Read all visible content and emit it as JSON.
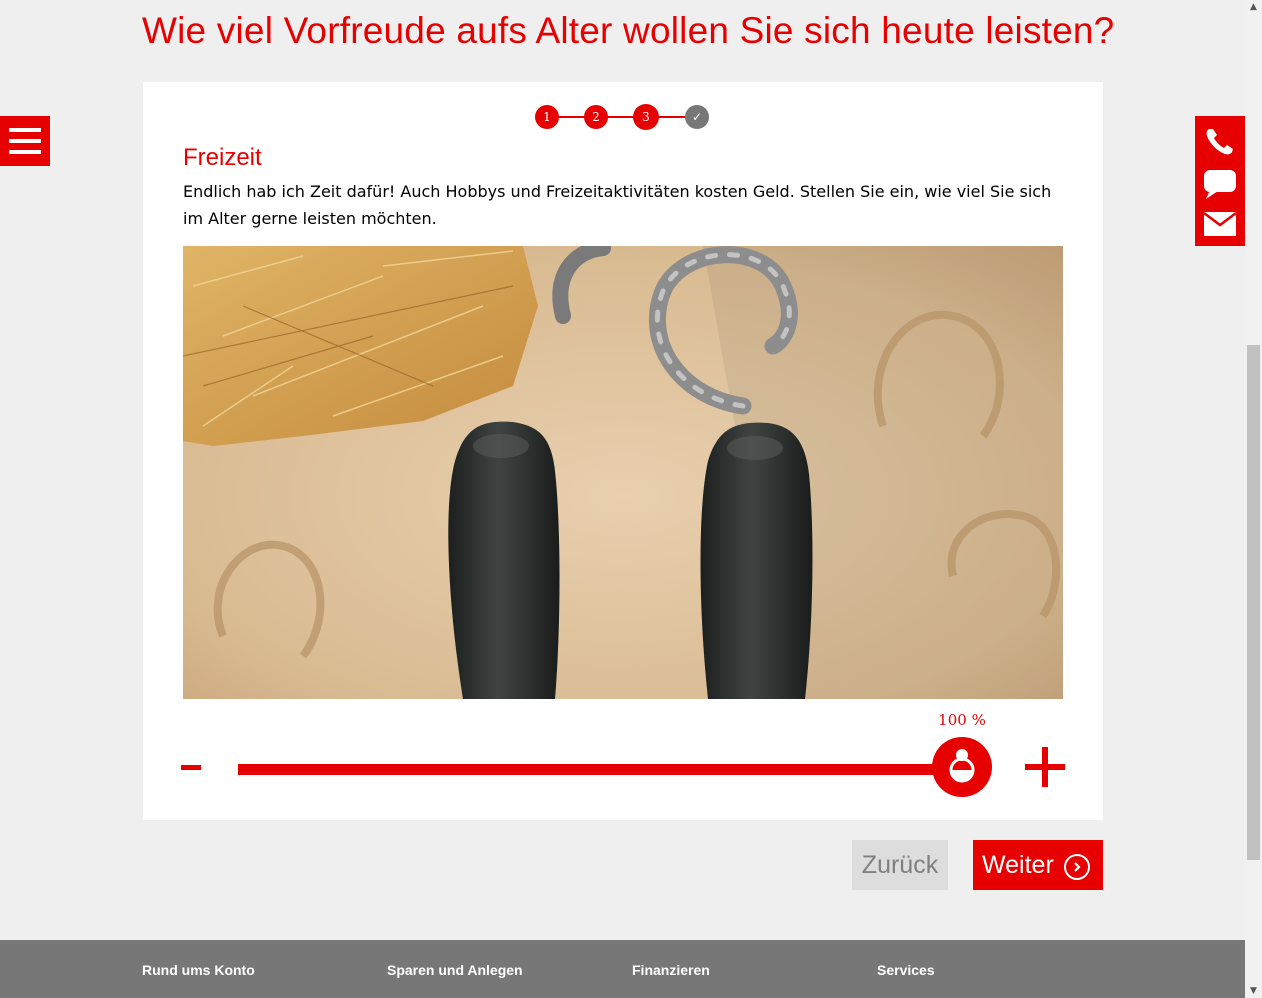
{
  "page": {
    "title": "Wie viel Vorfreude aufs Alter wollen Sie sich heute leisten?"
  },
  "colors": {
    "accent": "#e60000",
    "done_step": "#777777",
    "footer": "#777777",
    "background": "#efefef"
  },
  "menu": {
    "icon": "hamburger-menu-icon"
  },
  "contact": {
    "icons": [
      "phone-icon",
      "chat-icon",
      "mail-icon"
    ]
  },
  "stepper": {
    "steps": [
      {
        "label": "1",
        "state": "completed"
      },
      {
        "label": "2",
        "state": "completed"
      },
      {
        "label": "3",
        "state": "current"
      },
      {
        "label": "✓",
        "state": "pending"
      }
    ]
  },
  "section": {
    "title": "Freizeit",
    "text": "Endlich hab ich Zeit dafür! Auch Hobbys und Freizeitaktivitäten kosten Geld. Stellen Sie ein, wie viel Sie sich im Alter gerne leisten möchten."
  },
  "image": {
    "description_icon": "boots-horseshoes-photo"
  },
  "slider": {
    "value_label": "100 %",
    "value": 100,
    "min": 0,
    "max": 100,
    "minus_label": "-",
    "plus_label": "+",
    "handle_icon": "smiley-icon"
  },
  "buttons": {
    "back_label": "Zurück",
    "next_label": "Weiter",
    "next_icon": "chevron-right-icon"
  },
  "footer": {
    "columns": [
      {
        "title": "Rund ums Konto"
      },
      {
        "title": "Sparen und Anlegen"
      },
      {
        "title": "Finanzieren"
      },
      {
        "title": "Services"
      }
    ]
  }
}
